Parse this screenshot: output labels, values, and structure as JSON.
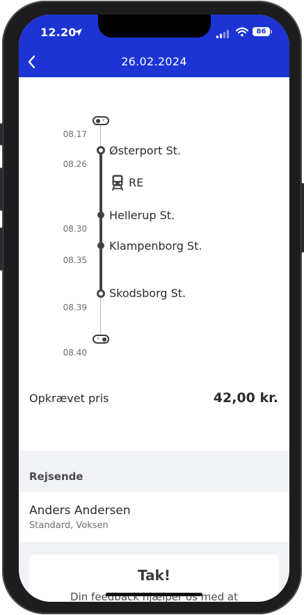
{
  "status_bar": {
    "time": "12.20",
    "battery": "86"
  },
  "header": {
    "title": "26.02.2024"
  },
  "journey": {
    "check_in_time": "08.17",
    "check_out_time": "08.40",
    "train_label": "RE",
    "stops": [
      {
        "time": "08.26",
        "name": "Østerport St."
      },
      {
        "time": "08.30",
        "name": "Hellerup St."
      },
      {
        "time": "08.35",
        "name": "Klampenborg St."
      },
      {
        "time": "08.39",
        "name": "Skodsborg St."
      }
    ]
  },
  "price": {
    "label": "Opkrævet pris",
    "value": "42,00 kr."
  },
  "travelers": {
    "section_title": "Rejsende",
    "name": "Anders Andersen",
    "details": "Standard, Voksen"
  },
  "feedback": {
    "title": "Tak!",
    "text": "Din feedback hjælper os med at"
  },
  "colors": {
    "header_blue": "#1c34d4",
    "line_dark": "#434346",
    "background_grey": "#f1f2f5"
  },
  "icons": [
    "location-arrow-icon",
    "signal-icon",
    "wifi-icon",
    "battery-icon",
    "back-chevron-icon",
    "train-icon",
    "check-in-icon",
    "check-out-icon"
  ]
}
